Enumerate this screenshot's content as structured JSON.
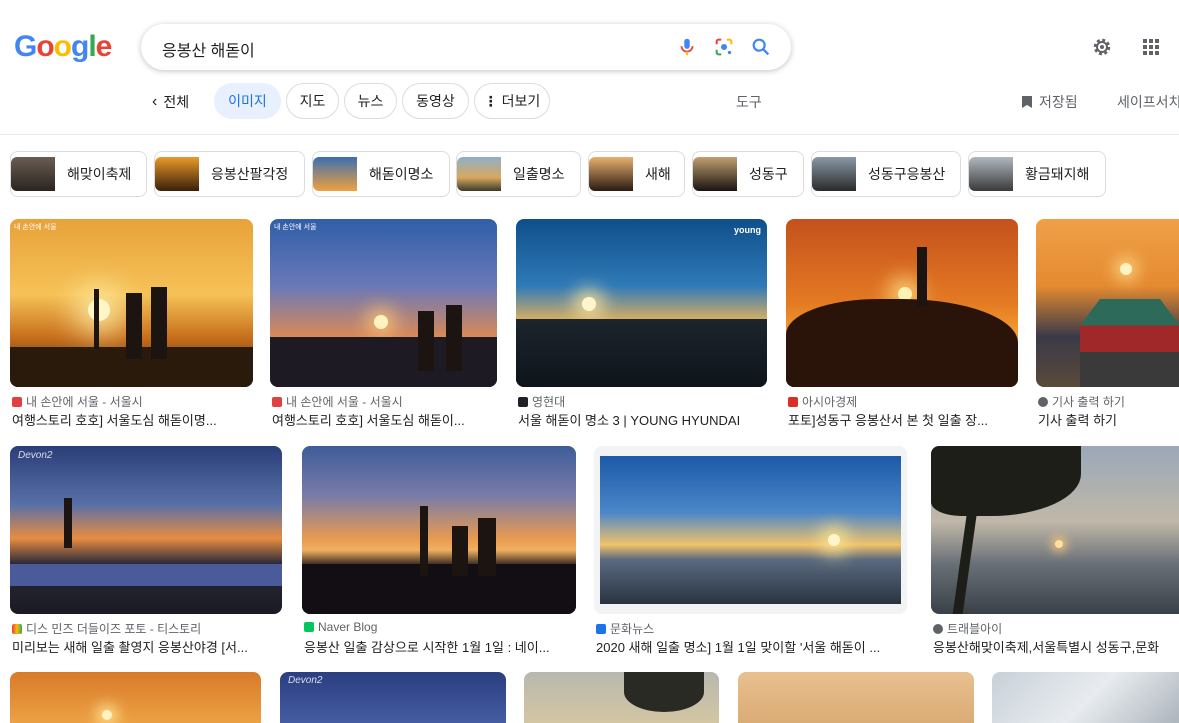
{
  "search": {
    "query": "응봉산 해돋이"
  },
  "logo": {
    "letters": [
      "G",
      "o",
      "o",
      "g",
      "l",
      "e"
    ],
    "colors": [
      "#4285f4",
      "#ea4335",
      "#fbbc05",
      "#4285f4",
      "#34a853",
      "#ea4335"
    ]
  },
  "tabs": {
    "back": "전체",
    "items": [
      "이미지",
      "지도",
      "뉴스",
      "동영상",
      "더보기"
    ],
    "tools": "도구",
    "saved": "저장됨",
    "safe": "세이프서치"
  },
  "related": [
    "해맞이축제",
    "응봉산팔각정",
    "해돋이명소",
    "일출명소",
    "새해",
    "성동구",
    "성동구응봉산",
    "황금돼지해"
  ],
  "results": [
    {
      "source": "내 손안에 서울 - 서울시",
      "title": "여행스토리 호호] 서울도심 해돋이명..."
    },
    {
      "source": "내 손안에 서울 - 서울시",
      "title": "여행스토리 호호] 서울도심 해돋이..."
    },
    {
      "source": "영현대",
      "title": "서울 해돋이 명소 3 | YOUNG HYUNDAI"
    },
    {
      "source": "아시아경제",
      "title": "포토]성동구 응봉산서 본 첫 일출 장..."
    },
    {
      "source": "기사 출력 하기",
      "title": "기사 출력 하기"
    },
    {
      "source": "디스 민즈 더들이즈 포토 - 티스토리",
      "title": "미리보는 새해 일출 촬영지 응봉산야경 [서..."
    },
    {
      "source": "Naver Blog",
      "title": "응봉산 일출 감상으로 시작한 1월 1일 : 네이..."
    },
    {
      "source": "문화뉴스",
      "title": "2020 새해 일출 명소] 1월 1일 맞이할 '서울 해돋이 ..."
    },
    {
      "source": "트래블아이",
      "title": "응봉산해맞이축제,서울특별시 성동구,문화"
    }
  ],
  "overlays": {
    "seoul": "내 손안에 서울",
    "young": "young",
    "devon": "Devon2"
  },
  "colors": {
    "accent": "#1a73e8",
    "chip_active_bg": "#e8f0fe"
  }
}
